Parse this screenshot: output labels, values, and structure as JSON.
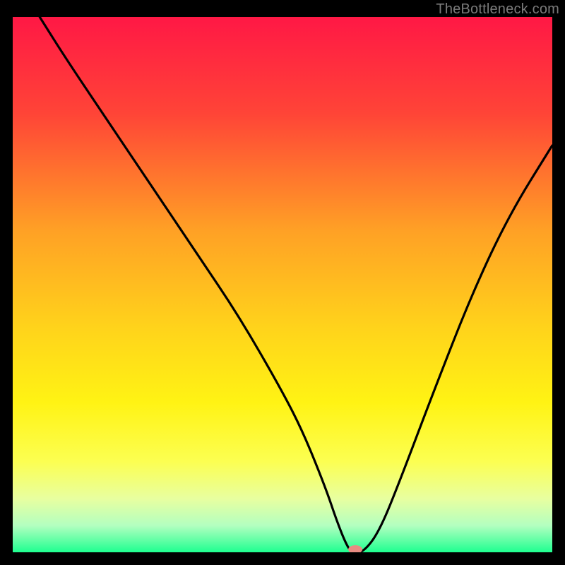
{
  "watermark": "TheBottleneck.com",
  "chart_data": {
    "type": "line",
    "title": "",
    "xlabel": "",
    "ylabel": "",
    "xlim": [
      0,
      100
    ],
    "ylim": [
      0,
      100
    ],
    "background": {
      "type": "vertical-gradient",
      "stops": [
        {
          "offset": 0,
          "color": "#ff1845"
        },
        {
          "offset": 18,
          "color": "#ff4437"
        },
        {
          "offset": 40,
          "color": "#ffa125"
        },
        {
          "offset": 58,
          "color": "#ffd31b"
        },
        {
          "offset": 72,
          "color": "#fff314"
        },
        {
          "offset": 83,
          "color": "#fcff51"
        },
        {
          "offset": 90,
          "color": "#e8ffa0"
        },
        {
          "offset": 95,
          "color": "#b3ffc0"
        },
        {
          "offset": 100,
          "color": "#1fff90"
        }
      ]
    },
    "series": [
      {
        "name": "bottleneck-curve",
        "color": "#000000",
        "x": [
          5,
          10,
          18,
          26,
          34,
          42,
          50,
          54,
          58,
          60,
          62,
          63,
          65,
          68,
          72,
          78,
          85,
          92,
          100
        ],
        "values": [
          100,
          92,
          80,
          68,
          56,
          44,
          30,
          22,
          12,
          6,
          1,
          0,
          0,
          4,
          14,
          30,
          48,
          63,
          76
        ]
      }
    ],
    "marker": {
      "name": "optimal-point",
      "x": 63.5,
      "y": 0,
      "color": "#e88b82",
      "rx": 10,
      "ry": 6
    }
  }
}
